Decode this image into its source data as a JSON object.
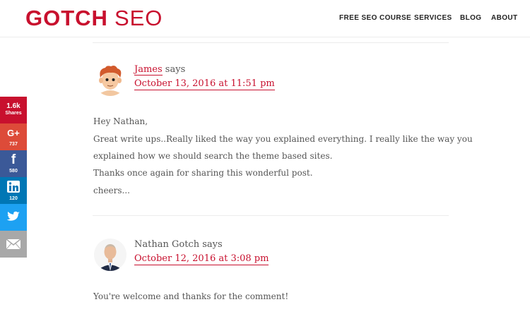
{
  "brand": {
    "bold": "GOTCH",
    "light": "SEO"
  },
  "nav": [
    "FREE SEO COURSE",
    "SERVICES",
    "BLOG",
    "ABOUT"
  ],
  "share": {
    "total": "1.6k",
    "total_label": "Shares",
    "google_plus": "737",
    "facebook": "580",
    "linkedin": "120"
  },
  "comments": [
    {
      "author": "James",
      "says": "says",
      "date": "October 13, 2016 at 11:51 pm",
      "lines": [
        "Hey Nathan,",
        "Great write ups..Really liked the way you explained everything. I really like the way you",
        "explained how we should search the theme based sites.",
        "Thanks once again for sharing this wonderful post.",
        "cheers..."
      ]
    },
    {
      "author": "Nathan Gotch",
      "says": "says",
      "date": "October 12, 2016 at 3:08 pm",
      "lines": [
        "You're welcome and thanks for the comment!"
      ]
    }
  ],
  "colors": {
    "brand_red": "#c8102e",
    "total": "#c8102e",
    "google_plus": "#dd4b39",
    "facebook": "#3b5998",
    "linkedin": "#0077b5",
    "twitter": "#1da1f2",
    "email": "#a8a8a8"
  }
}
